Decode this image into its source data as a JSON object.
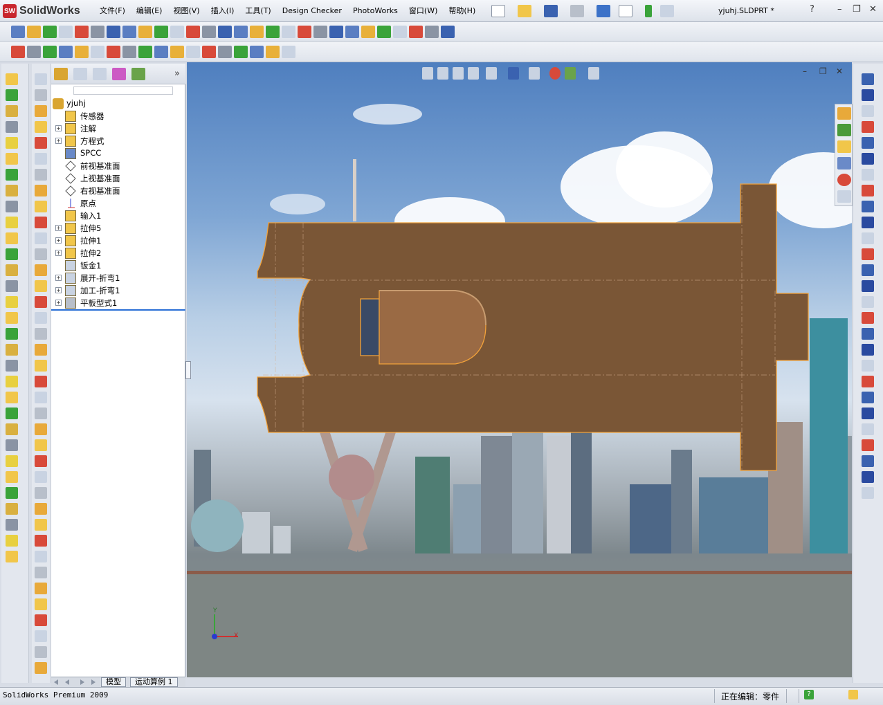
{
  "app": {
    "name": "SolidWorks",
    "logo_badge": "SW",
    "document_title": "yjuhj.SLDPRT *"
  },
  "menu": [
    "文件(F)",
    "编辑(E)",
    "视图(V)",
    "插入(I)",
    "工具(T)",
    "Design Checker",
    "PhotoWorks",
    "窗口(W)",
    "帮助(H)"
  ],
  "window_controls": {
    "help": "?",
    "minimize": "–",
    "restore": "❐",
    "close": "✕"
  },
  "toolbar1_icons": [
    "spellcheck-icon",
    "link-icon",
    "table-icon",
    "dimension-icon",
    "checkbox-icon",
    "mass-icon",
    "sum-icon",
    "compare-icon",
    "stats-icon",
    "gear-icon",
    "mirror-icon",
    "toggle-icon",
    "stop-icon",
    "triad-icon",
    "view-iso-icon",
    "view-front-icon",
    "view-top-icon",
    "view-right-icon",
    "view-left-icon",
    "view-bottom-icon",
    "view-back-icon",
    "view-normal-icon",
    "sketch-icon",
    "measure-icon",
    "section-icon",
    "shaded-icon",
    "hidden-icon",
    "sphere-icon"
  ],
  "toolbar2_icons": [
    "3d-sketch-icon",
    "cube-icon",
    "snap-icon",
    "grid-icon",
    "relations-icon",
    "display-icon",
    "hidden-lines-icon",
    "link-icon",
    "sketch-plane-icon",
    "box-icon",
    "tower-icon",
    "tag-icon",
    "tree-icon",
    "play-icon",
    "stop-icon",
    "record-icon",
    "macro-icon",
    "edit-macro-icon"
  ],
  "feature_tree": {
    "filter_value": "",
    "root": "yjuhj",
    "items": [
      {
        "label": "传感器",
        "icon": "sensor-icon",
        "expand": false
      },
      {
        "label": "注解",
        "icon": "annotation-icon",
        "expand": true
      },
      {
        "label": "方程式",
        "icon": "equation-icon",
        "expand": true
      },
      {
        "label": "SPCC",
        "icon": "material-icon",
        "expand": false
      },
      {
        "label": "前视基准面",
        "icon": "plane-icon",
        "expand": false
      },
      {
        "label": "上视基准面",
        "icon": "plane-icon",
        "expand": false
      },
      {
        "label": "右视基准面",
        "icon": "plane-icon",
        "expand": false
      },
      {
        "label": "原点",
        "icon": "origin-icon",
        "expand": false
      },
      {
        "label": "输入1",
        "icon": "import-icon",
        "expand": false
      },
      {
        "label": "拉伸5",
        "icon": "extrude-icon",
        "expand": true
      },
      {
        "label": "拉伸1",
        "icon": "extrude-icon",
        "expand": true
      },
      {
        "label": "拉伸2",
        "icon": "extrude-icon",
        "expand": true
      },
      {
        "label": "钣金1",
        "icon": "sheetmetal-icon",
        "expand": false
      },
      {
        "label": "展开-折弯1",
        "icon": "unfold-icon",
        "expand": true
      },
      {
        "label": "加工-折弯1",
        "icon": "process-bend-icon",
        "expand": true
      },
      {
        "label": "平板型式1",
        "icon": "flat-pattern-icon",
        "expand": true
      }
    ]
  },
  "bottom_tabs": [
    "模型",
    "运动算例 1"
  ],
  "status": {
    "app_version": "SolidWorks Premium 2009",
    "editing": "正在编辑：零件",
    "help_badge": "?"
  },
  "colors": {
    "part_fill": "#7a5636",
    "part_edge": "#f2a23a",
    "selection": "#2a6fd6",
    "title_red": "#c8262d"
  },
  "triad": {
    "x_label": "X",
    "y_label": "Y"
  }
}
